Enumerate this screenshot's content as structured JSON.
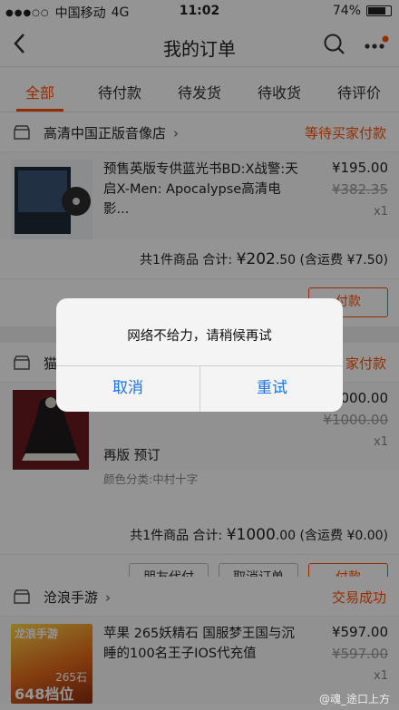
{
  "status_bar": {
    "carrier": "中国移动",
    "network": "4G",
    "time": "11:02",
    "battery_text": "74%",
    "battery_level": 0.74
  },
  "navbar": {
    "back_icon": "chevron-left-icon",
    "title": "我的订单",
    "search_icon": "search-icon",
    "more_icon": "more-dots-icon"
  },
  "tabs": [
    "全部",
    "待付款",
    "待发货",
    "待收货",
    "待评价"
  ],
  "orders": [
    {
      "shop": "高清中国正版音像店",
      "status": "等待买家付款",
      "title": "预售英版专供蓝光书BD:X战警:天启X-Men: Apocalypse高清电影...",
      "price": "¥195.00",
      "original_price": "¥382.35",
      "qty": "x1",
      "summary_count": "共1件商品 合计:",
      "summary_total_int": "¥202",
      "summary_total_dec": ".50",
      "summary_shipping": "(含运费 ¥7.50)",
      "action_primary": "付款"
    },
    {
      "shop": "猫",
      "status": "家付款",
      "title_line2": "再版 预订",
      "sub": "颜色分类:中村十字",
      "price": "000.00",
      "original_price": "¥1000.00",
      "qty": "x1",
      "summary_count": "共1件商品 合计:",
      "summary_total_int": "¥1000",
      "summary_total_dec": ".00",
      "summary_shipping": "(含运费 ¥0.00)",
      "action_1": "朋友代付",
      "action_2": "取消订单",
      "action_primary": "付款"
    },
    {
      "shop": "沧浪手游",
      "status": "交易成功",
      "title": "苹果 265妖精石 国服梦王国与沉睡的100名王子IOS代充值",
      "price": "¥597.00",
      "original_price": "¥597.00",
      "qty": "x1",
      "thumb_text_top": "龙浪手游",
      "thumb_text_mid": "265石",
      "thumb_text_bottom": "648档位"
    }
  ],
  "alert": {
    "message": "网络不给力，请稍候再试",
    "cancel": "取消",
    "retry": "重试"
  },
  "watermark": "@魂_途口上方",
  "colors": {
    "accent": "#ff5000",
    "link": "#1a73e8"
  }
}
